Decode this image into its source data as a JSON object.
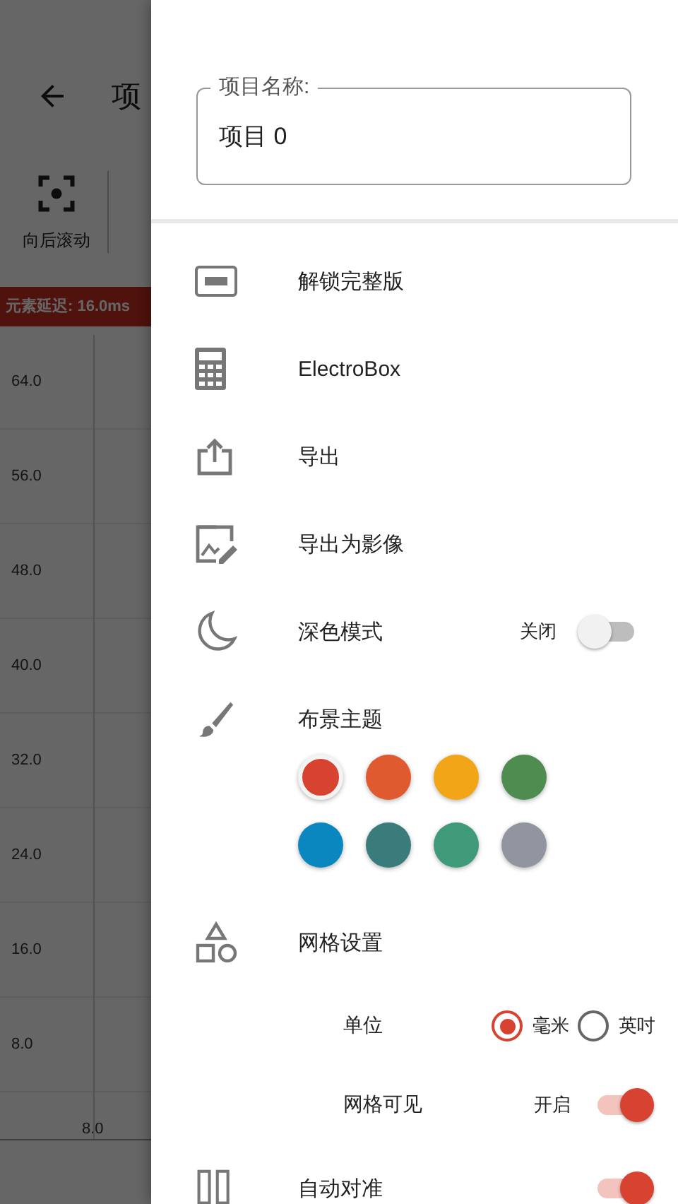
{
  "background": {
    "title": "项",
    "toolbar": [
      {
        "label": "向后滚动"
      }
    ],
    "status_banner": "元素延迟: 16.0ms",
    "y_axis_labels": [
      "64.0",
      "56.0",
      "48.0",
      "40.0",
      "32.0",
      "24.0",
      "16.0",
      "8.0"
    ],
    "x_axis_labels": [
      "8.0"
    ]
  },
  "drawer": {
    "project_name": {
      "label": "项目名称:",
      "value": "项目 0"
    },
    "menu_items": [
      {
        "label": "解锁完整版"
      },
      {
        "label": "ElectroBox"
      },
      {
        "label": "导出"
      },
      {
        "label": "导出为影像"
      }
    ],
    "dark_mode": {
      "label": "深色模式",
      "state_label": "关闭",
      "on": false
    },
    "theme": {
      "label": "布景主题",
      "colors": [
        {
          "color": "#d84230",
          "selected": true
        },
        {
          "color": "#e05a2f",
          "selected": false
        },
        {
          "color": "#f2a516",
          "selected": false
        },
        {
          "color": "#4e8d4f",
          "selected": false
        },
        {
          "color": "#0b87c0",
          "selected": false
        },
        {
          "color": "#3a7b7c",
          "selected": false
        },
        {
          "color": "#3f9a7a",
          "selected": false
        },
        {
          "color": "#9095a0",
          "selected": false
        }
      ]
    },
    "grid_settings": {
      "label": "网格设置",
      "unit": {
        "label": "单位",
        "options": [
          {
            "label": "毫米",
            "selected": true
          },
          {
            "label": "英吋",
            "selected": false
          }
        ]
      },
      "visible": {
        "label": "网格可见",
        "state_label": "开启",
        "on": true
      }
    },
    "auto_align": {
      "label": "自动对准",
      "on": true
    }
  }
}
